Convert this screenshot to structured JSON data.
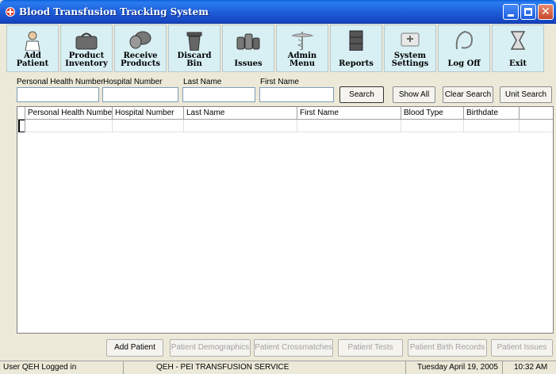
{
  "window": {
    "title": "Blood Transfusion Tracking System"
  },
  "toolbar": [
    {
      "line1": "Add",
      "line2": "Patient",
      "icon": "person-icon"
    },
    {
      "line1": "Product",
      "line2": "Inventory",
      "icon": "bag-icon"
    },
    {
      "line1": "Receive",
      "line2": "Products",
      "icon": "shield-icon"
    },
    {
      "line1": "Discard",
      "line2": "Bin",
      "icon": "bin-icon"
    },
    {
      "line1": "",
      "line2": "Issues",
      "icon": "bottles-icon"
    },
    {
      "line1": "Admin",
      "line2": "Menu",
      "icon": "caduceus-icon"
    },
    {
      "line1": "",
      "line2": "Reports",
      "icon": "cabinet-icon"
    },
    {
      "line1": "System",
      "line2": "Settings",
      "icon": "medical-kit-icon"
    },
    {
      "line1": "",
      "line2": "Log Off",
      "icon": "logoff-icon"
    },
    {
      "line1": "",
      "line2": "Exit",
      "icon": "exit-icon"
    }
  ],
  "search": {
    "phn_label": "Personal Health Number",
    "hosp_label": "Hospital Number",
    "last_label": "Last Name",
    "first_label": "First Name",
    "phn_value": "",
    "hosp_value": "",
    "last_value": "",
    "first_value": "",
    "search_btn": "Search",
    "showall_btn": "Show All",
    "clear_btn": "Clear Search",
    "unit_btn": "Unit Search"
  },
  "grid": {
    "columns": [
      "Personal Health Number",
      "Hospital Number",
      "Last Name",
      "First Name",
      "Blood Type",
      "Birthdate"
    ],
    "rows": []
  },
  "bottom_buttons": [
    {
      "label": "Add Patient",
      "enabled": true
    },
    {
      "label": "Patient Demographics",
      "enabled": false
    },
    {
      "label": "Patient Crossmatches",
      "enabled": false
    },
    {
      "label": "Patient Tests",
      "enabled": false
    },
    {
      "label": "Patient Birth Records",
      "enabled": false
    },
    {
      "label": "Patient Issues",
      "enabled": false
    }
  ],
  "status": {
    "user": "User QEH Logged in",
    "service": "QEH - PEI TRANSFUSION SERVICE",
    "date": "Tuesday April 19, 2005",
    "time": "10:32 AM"
  }
}
